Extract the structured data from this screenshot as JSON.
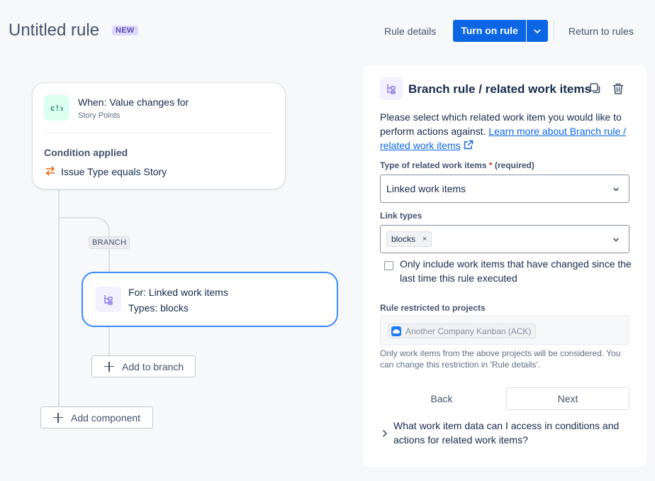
{
  "header": {
    "title": "Untitled rule",
    "badge": "NEW",
    "rule_details": "Rule details",
    "turn_on": "Turn on rule",
    "return": "Return to rules"
  },
  "canvas": {
    "trigger": {
      "title": "When: Value changes for",
      "subtitle": "Story Points",
      "icon_text": "c!ↄ",
      "condition_title": "Condition applied",
      "condition_text": "Issue Type equals Story"
    },
    "branch_label": "BRANCH",
    "branch_card": {
      "title": "For: Linked work items",
      "subtitle": "Types: blocks"
    },
    "add_to_branch": "Add to branch",
    "add_component": "Add component"
  },
  "panel": {
    "title": "Branch rule / related work items",
    "desc_prefix": "Please select which related work item you would like to perform actions against.",
    "desc_link": "Learn more about Branch rule / related work items",
    "type_label": "Type of related work items",
    "type_required_star": "*",
    "type_required": "(required)",
    "type_value": "Linked work items",
    "link_types_label": "Link types",
    "link_tag": "blocks",
    "link_tag_remove": "×",
    "checkbox_label": "Only include work items that have changed since the last time this rule executed",
    "restricted_label": "Rule restricted to projects",
    "project": "Another Company Kanban (ACK)",
    "helper": "Only work items from the above projects will be considered. You can change this restriction in 'Rule details'.",
    "back": "Back",
    "next": "Next",
    "faq": "What work item data can I access in conditions and actions for related work items?"
  },
  "colors": {
    "primary": "#0c66e4",
    "selected_border": "#388bff",
    "trigger_bg": "#dcfff1",
    "branch_icon_bg": "#f3f0ff",
    "badge_bg": "#dfd8fd",
    "condition_icon": "#e56910"
  }
}
